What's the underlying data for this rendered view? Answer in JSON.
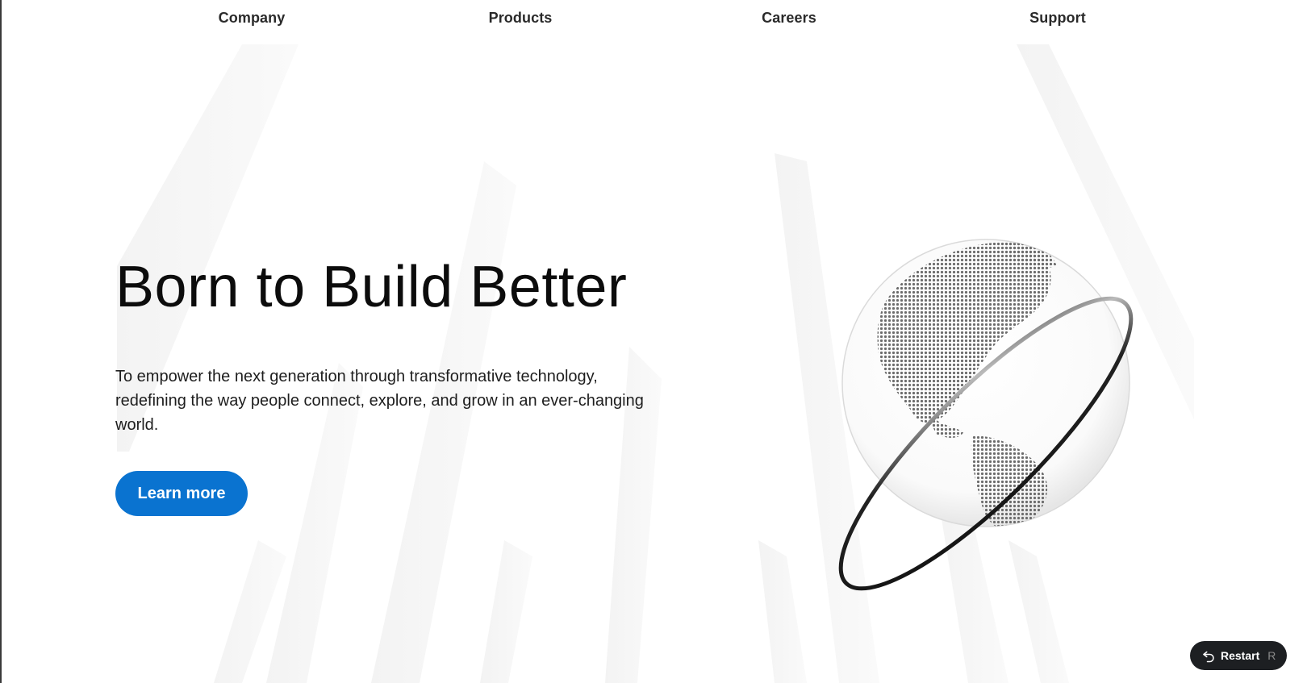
{
  "nav": {
    "items": [
      {
        "label": "Company"
      },
      {
        "label": "Products"
      },
      {
        "label": "Careers"
      },
      {
        "label": "Support"
      }
    ]
  },
  "hero": {
    "title": "Born to Build Better",
    "description": "To empower the next generation through transformative technology, redefining the way people connect, explore, and grow in an ever-changing world.",
    "cta_label": "Learn more"
  },
  "restart": {
    "label": "Restart",
    "shortcut": "R"
  },
  "colors": {
    "accent": "#0a73d0",
    "text": "#0c0c0c",
    "restart_bg": "#1d1f22"
  },
  "icons": {
    "globe": "globe-illustration",
    "restart": "undo-arrow-icon"
  }
}
